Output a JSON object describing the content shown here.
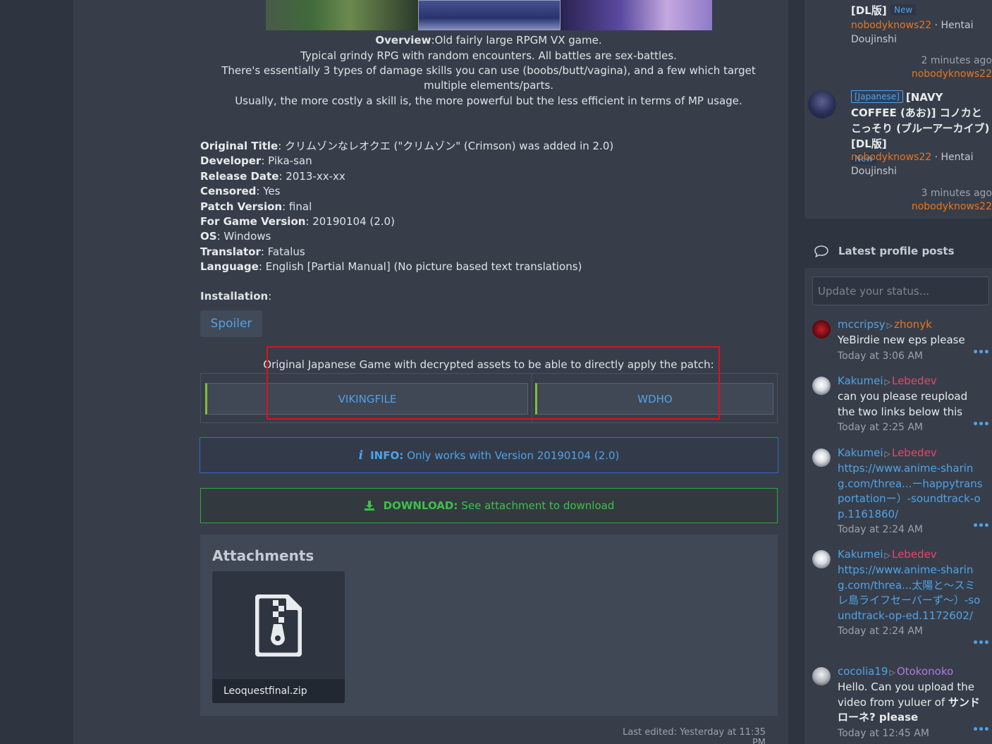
{
  "post": {
    "overview_label": "Overview",
    "overview_text": ":Old fairly large RPGM VX game.",
    "line2": "Typical grindy RPG with random encounters. All battles are sex-battles.",
    "line3": "There's essentially 3 types of damage skills you can use (boobs/butt/vagina), and a few which target multiple elements/parts.",
    "line4": "Usually, the more costly a skill is, the more powerful but the less efficient in terms of MP usage.",
    "meta": [
      {
        "label": "Original Title",
        "value": ": クリムゾンなレオクエ (\"クリムゾン\" (Crimson) was added in 2.0)"
      },
      {
        "label": "Developer",
        "value": ": Pika-san"
      },
      {
        "label": "Release Date",
        "value": ": 2013-xx-xx"
      },
      {
        "label": "Censored",
        "value": ": Yes"
      },
      {
        "label": "Patch Version",
        "value": ": final"
      },
      {
        "label": "For Game Version",
        "value": ": 20190104 (2.0)"
      },
      {
        "label": "OS",
        "value": ": Windows"
      },
      {
        "label": "Translator",
        "value": ": Fatalus"
      },
      {
        "label": "Language",
        "value": ": English [Partial Manual] (No picture based text translations)"
      }
    ],
    "installation_label": "Installation",
    "installation_colon": ":",
    "spoiler_label": "Spoiler",
    "patch_note": "Original Japanese Game with decrypted assets to be able to directly apply the patch:",
    "links": [
      "VIKINGFILE",
      "WDHO"
    ],
    "info_icon": "i",
    "info_label": "INFO:",
    "info_text": "Only works with Version 20190104 (2.0)",
    "download_label": "DOWNLOAD:",
    "download_text": "See attachment to download",
    "attachments_title": "Attachments",
    "attachment_name": "Leoquestfinal.zip",
    "last_edited": "Last edited: Yesterday at 11:35 PM"
  },
  "sidebar": {
    "threads": [
      {
        "title_partial": "[DL版]",
        "badge": "New",
        "user": "nobodyknows22",
        "category": " · Hentai Doujinshi",
        "time": "2 minutes ago",
        "last_user": "nobodyknows22"
      },
      {
        "lang": "[Japanese]",
        "title": "[NAVY COFFEE (あお)] コノカとこっそり (ブルーアーカイブ) [DL版]",
        "badge": "New",
        "user": "nobodyknows22",
        "category": " · Hentai Doujinshi",
        "time": "3 minutes ago",
        "last_user": "nobodyknows22"
      }
    ],
    "profile_posts_title": "Latest profile posts",
    "status_placeholder": "Update your status...",
    "posts": [
      {
        "from": "mccripsy",
        "to": "zhonyk",
        "text": "YeBirdie new eps please",
        "time": "Today at 3:06 AM"
      },
      {
        "from": "Kakumei",
        "to": "Lebedev",
        "text": "can you please reupload the two links below this",
        "time": "Today at 2:25 AM"
      },
      {
        "from": "Kakumei",
        "to": "Lebedev",
        "link": "https://www.anime-sharing.com/threa...ーhappytransportationー）-soundtrack-op.1161860/",
        "time": "Today at 2:24 AM"
      },
      {
        "from": "Kakumei",
        "to": "Lebedev",
        "link": "https://www.anime-sharing.com/threa...太陽と〜スミレ島ライフセーバーず〜）-soundtrack-op-ed.1172602/",
        "time": "Today at 2:24 AM"
      },
      {
        "from": "cocolia19",
        "to": "Otokonoko",
        "text": "Hello. Can you upload the video from yuluer of ",
        "text_bold": "サンドローネ? please",
        "time": "Today at 12:45 AM"
      }
    ],
    "more": "•••"
  },
  "colors": {
    "accent_blue": "#4fa3e8",
    "user_orange": "#e8761e",
    "download_green": "#3fc04a",
    "highlight_red": "#e0101a"
  }
}
